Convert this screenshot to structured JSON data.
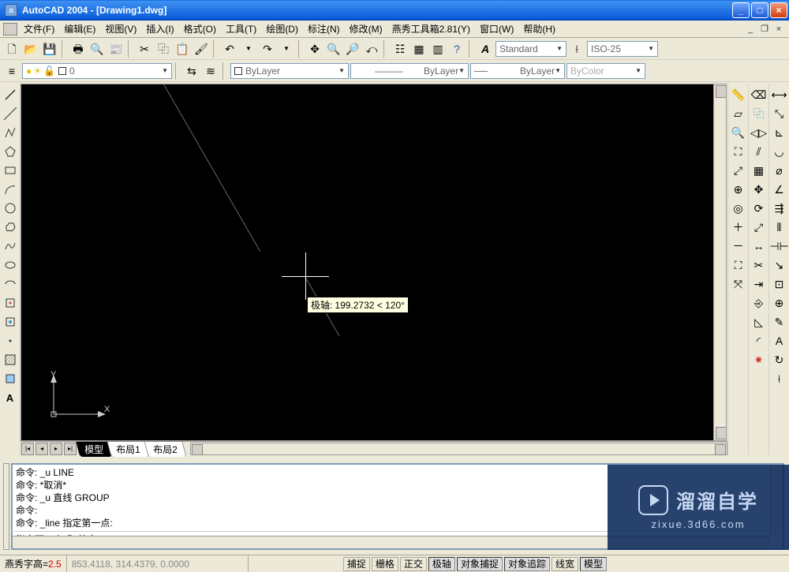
{
  "title": "AutoCAD 2004 - [Drawing1.dwg]",
  "menus": {
    "file": "文件(F)",
    "edit": "编辑(E)",
    "view": "视图(V)",
    "insert": "插入(I)",
    "format": "格式(O)",
    "tools": "工具(T)",
    "draw": "绘图(D)",
    "dimension": "标注(N)",
    "modify": "修改(M)",
    "yanxiu": "燕秀工具箱2.81(Y)",
    "window": "窗口(W)",
    "help": "帮助(H)"
  },
  "styles": {
    "text_style": "Standard",
    "dim_style": "ISO-25"
  },
  "layer": {
    "current": "0",
    "linetype": "ByLayer",
    "lineweight": "ByLayer",
    "plotstyle": "ByLayer",
    "color": "ByColor"
  },
  "tooltip": {
    "label": "极轴:",
    "value": "199.2732 < 120°"
  },
  "ucs": {
    "x": "X",
    "y": "Y"
  },
  "tabs": {
    "model": "模型",
    "layout1": "布局1",
    "layout2": "布局2"
  },
  "cmd": {
    "l1": "命令:  _u LINE",
    "l2": "命令: *取消*",
    "l3": "命令:  _u 直线  GROUP",
    "l4": "命令:",
    "l5": "命令: _line 指定第一点:",
    "prompt": "指定下一点或 [放弃(U)]:"
  },
  "status": {
    "fontheight_label": "燕秀字高=",
    "fontheight_val": "2.5",
    "coords": "853.4118,  314.4379, 0.0000",
    "snap": "捕捉",
    "grid": "栅格",
    "ortho": "正交",
    "polar": "极轴",
    "osnap": "对象捕捉",
    "otrack": "对象追踪",
    "lwt": "线宽",
    "model": "模型"
  },
  "watermark": {
    "brand": "溜溜自学",
    "url": "zixue.3d66.com"
  }
}
